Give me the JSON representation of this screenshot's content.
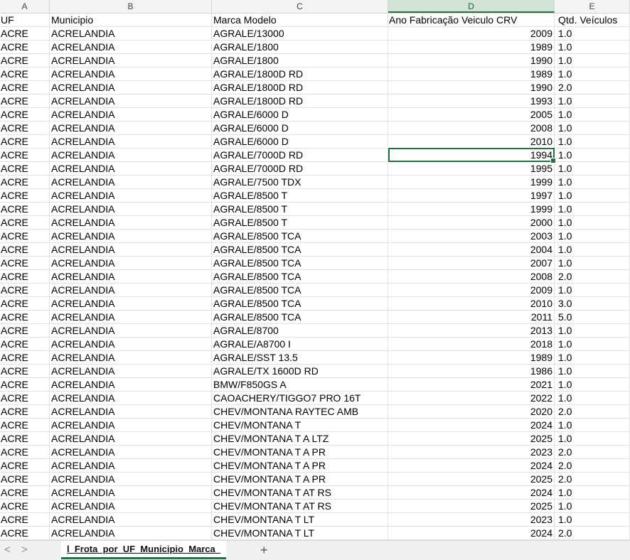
{
  "columns": {
    "a": "A",
    "b": "B",
    "c": "C",
    "d": "D",
    "e": "E"
  },
  "header_row": {
    "uf": "UF",
    "municipio": "Municipio",
    "marca_modelo": "Marca Modelo",
    "ano": "Ano Fabricação Veiculo CRV",
    "qtd": "Qtd. Veículos"
  },
  "rows": [
    [
      "ACRE",
      "ACRELANDIA",
      "AGRALE/13000",
      "2009",
      "1.0"
    ],
    [
      "ACRE",
      "ACRELANDIA",
      "AGRALE/1800",
      "1989",
      "1.0"
    ],
    [
      "ACRE",
      "ACRELANDIA",
      "AGRALE/1800",
      "1990",
      "1.0"
    ],
    [
      "ACRE",
      "ACRELANDIA",
      "AGRALE/1800D RD",
      "1989",
      "1.0"
    ],
    [
      "ACRE",
      "ACRELANDIA",
      "AGRALE/1800D RD",
      "1990",
      "2.0"
    ],
    [
      "ACRE",
      "ACRELANDIA",
      "AGRALE/1800D RD",
      "1993",
      "1.0"
    ],
    [
      "ACRE",
      "ACRELANDIA",
      "AGRALE/6000 D",
      "2005",
      "1.0"
    ],
    [
      "ACRE",
      "ACRELANDIA",
      "AGRALE/6000 D",
      "2008",
      "1.0"
    ],
    [
      "ACRE",
      "ACRELANDIA",
      "AGRALE/6000 D",
      "2010",
      "1.0"
    ],
    [
      "ACRE",
      "ACRELANDIA",
      "AGRALE/7000D RD",
      "1994",
      "1.0"
    ],
    [
      "ACRE",
      "ACRELANDIA",
      "AGRALE/7000D RD",
      "1995",
      "1.0"
    ],
    [
      "ACRE",
      "ACRELANDIA",
      "AGRALE/7500 TDX",
      "1999",
      "1.0"
    ],
    [
      "ACRE",
      "ACRELANDIA",
      "AGRALE/8500 T",
      "1997",
      "1.0"
    ],
    [
      "ACRE",
      "ACRELANDIA",
      "AGRALE/8500 T",
      "1999",
      "1.0"
    ],
    [
      "ACRE",
      "ACRELANDIA",
      "AGRALE/8500 T",
      "2000",
      "1.0"
    ],
    [
      "ACRE",
      "ACRELANDIA",
      "AGRALE/8500 TCA",
      "2003",
      "1.0"
    ],
    [
      "ACRE",
      "ACRELANDIA",
      "AGRALE/8500 TCA",
      "2004",
      "1.0"
    ],
    [
      "ACRE",
      "ACRELANDIA",
      "AGRALE/8500 TCA",
      "2007",
      "1.0"
    ],
    [
      "ACRE",
      "ACRELANDIA",
      "AGRALE/8500 TCA",
      "2008",
      "2.0"
    ],
    [
      "ACRE",
      "ACRELANDIA",
      "AGRALE/8500 TCA",
      "2009",
      "1.0"
    ],
    [
      "ACRE",
      "ACRELANDIA",
      "AGRALE/8500 TCA",
      "2010",
      "3.0"
    ],
    [
      "ACRE",
      "ACRELANDIA",
      "AGRALE/8500 TCA",
      "2011",
      "5.0"
    ],
    [
      "ACRE",
      "ACRELANDIA",
      "AGRALE/8700",
      "2013",
      "1.0"
    ],
    [
      "ACRE",
      "ACRELANDIA",
      "AGRALE/A8700 I",
      "2018",
      "1.0"
    ],
    [
      "ACRE",
      "ACRELANDIA",
      "AGRALE/SST 13.5",
      "1989",
      "1.0"
    ],
    [
      "ACRE",
      "ACRELANDIA",
      "AGRALE/TX 1600D RD",
      "1986",
      "1.0"
    ],
    [
      "ACRE",
      "ACRELANDIA",
      "BMW/F850GS A",
      "2021",
      "1.0"
    ],
    [
      "ACRE",
      "ACRELANDIA",
      "CAOACHERY/TIGGO7 PRO 16T",
      "2022",
      "1.0"
    ],
    [
      "ACRE",
      "ACRELANDIA",
      "CHEV/MONTANA RAYTEC AMB",
      "2020",
      "2.0"
    ],
    [
      "ACRE",
      "ACRELANDIA",
      "CHEV/MONTANA T",
      "2024",
      "1.0"
    ],
    [
      "ACRE",
      "ACRELANDIA",
      "CHEV/MONTANA T A LTZ",
      "2025",
      "1.0"
    ],
    [
      "ACRE",
      "ACRELANDIA",
      "CHEV/MONTANA T A PR",
      "2023",
      "2.0"
    ],
    [
      "ACRE",
      "ACRELANDIA",
      "CHEV/MONTANA T A PR",
      "2024",
      "2.0"
    ],
    [
      "ACRE",
      "ACRELANDIA",
      "CHEV/MONTANA T A PR",
      "2025",
      "2.0"
    ],
    [
      "ACRE",
      "ACRELANDIA",
      "CHEV/MONTANA T AT RS",
      "2024",
      "1.0"
    ],
    [
      "ACRE",
      "ACRELANDIA",
      "CHEV/MONTANA T AT RS",
      "2025",
      "1.0"
    ],
    [
      "ACRE",
      "ACRELANDIA",
      "CHEV/MONTANA T LT",
      "2023",
      "1.0"
    ],
    [
      "ACRE",
      "ACRELANDIA",
      "CHEV/MONTANA T LT",
      "2024",
      "2.0"
    ]
  ],
  "active_cell_row_index": 10,
  "selected_column": "D",
  "tabbar": {
    "prev": "<",
    "next": ">",
    "sheet_tab": "l_Frota_por_UF_Municipio_Marca_",
    "add": "+"
  }
}
